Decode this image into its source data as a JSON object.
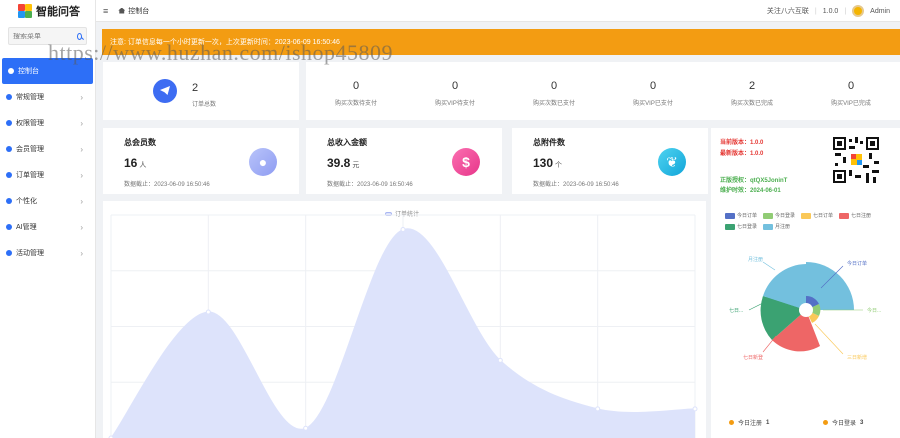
{
  "app": {
    "title": "智能问答"
  },
  "sidebar": {
    "search_placeholder": "搜索菜单",
    "items": [
      {
        "label": "控制台"
      },
      {
        "label": "常规管理"
      },
      {
        "label": "权限管理"
      },
      {
        "label": "会员管理"
      },
      {
        "label": "订单管理"
      },
      {
        "label": "个性化"
      },
      {
        "label": "AI管理"
      },
      {
        "label": "活动管理"
      }
    ]
  },
  "topbar": {
    "menu_icon": "≡",
    "home_tab": "控制台",
    "follow": "关注八六互联",
    "version": "1.0.0",
    "user": "Admin"
  },
  "notice": {
    "text": "注意: 订单信息每一个小时更新一次，上次更新时间：2023-06-09 16:50:46"
  },
  "watermark": "https://www.huzhan.com/ishop45809",
  "order_card": {
    "value": "2",
    "label": "订单总数"
  },
  "stats": [
    {
      "value": "0",
      "label": "购买次数待支付"
    },
    {
      "value": "0",
      "label": "购买VIP待支付"
    },
    {
      "value": "0",
      "label": "购买次数已支付"
    },
    {
      "value": "0",
      "label": "购买VIP已支付"
    },
    {
      "value": "2",
      "label": "购买次数已完成"
    },
    {
      "value": "0",
      "label": "购买VIP已完成"
    }
  ],
  "summary": [
    {
      "title": "总会员数",
      "value": "16",
      "unit": "人",
      "time": "数据截止：2023-06-09 16:50:46",
      "icon": "users-icon"
    },
    {
      "title": "总收入金额",
      "value": "39.8",
      "unit": "元",
      "time": "数据截止：2023-06-09 16:50:46",
      "icon": "dollar-icon"
    },
    {
      "title": "总附件数",
      "value": "130",
      "unit": "个",
      "time": "数据截止：2023-06-09 16:50:46",
      "icon": "leaf-icon"
    }
  ],
  "chart_data": {
    "type": "area",
    "series": [
      {
        "name": "订单统计",
        "values": [
          0,
          2.6,
          0.2,
          4.3,
          1.6,
          0.6,
          0.6
        ]
      }
    ],
    "color": "#dde3fb",
    "ylim": [
      0,
      4.6
    ],
    "grid": true
  },
  "right_panel": {
    "current_version": "当前版本：1.0.0",
    "latest_version": "最新版本：1.0.0",
    "authorized_account": "正版授权：qtQX5JoninT",
    "expiry": "维护时效：2024-06-01",
    "pie_legend": [
      {
        "label": "今日订单",
        "color": "#5470c6"
      },
      {
        "label": "今日登录",
        "color": "#91cc75"
      },
      {
        "label": "七日订单",
        "color": "#fac858"
      },
      {
        "label": "七日注册",
        "color": "#ee6666"
      },
      {
        "label": "七日登录",
        "color": "#3ba272"
      },
      {
        "label": "月注册",
        "color": "#73c0de"
      }
    ],
    "pie_labels": [
      "今日订单",
      "今日...",
      "七日...",
      "七日新登",
      "三日新增",
      "月注册"
    ],
    "bottom": [
      {
        "label": "今日注册",
        "value": "1"
      },
      {
        "label": "今日登录",
        "value": "3"
      }
    ]
  }
}
